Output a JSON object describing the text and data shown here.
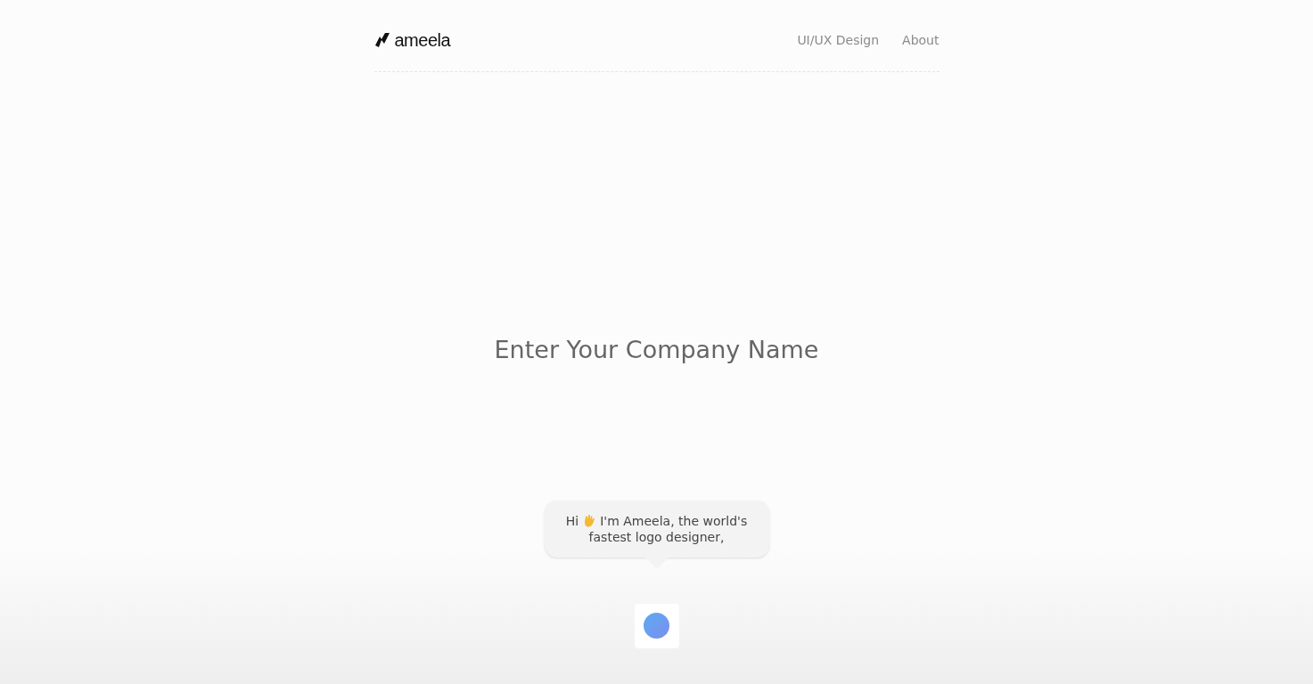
{
  "header": {
    "logo": "ameela",
    "nav": [
      {
        "label": "UI/UX Design"
      },
      {
        "label": "About"
      }
    ]
  },
  "heading": "Enter Your Company Name",
  "bubble": {
    "greeting": "Hi",
    "lines": [
      "I'm Ameela, the world's",
      "fastest logo designer,"
    ]
  }
}
